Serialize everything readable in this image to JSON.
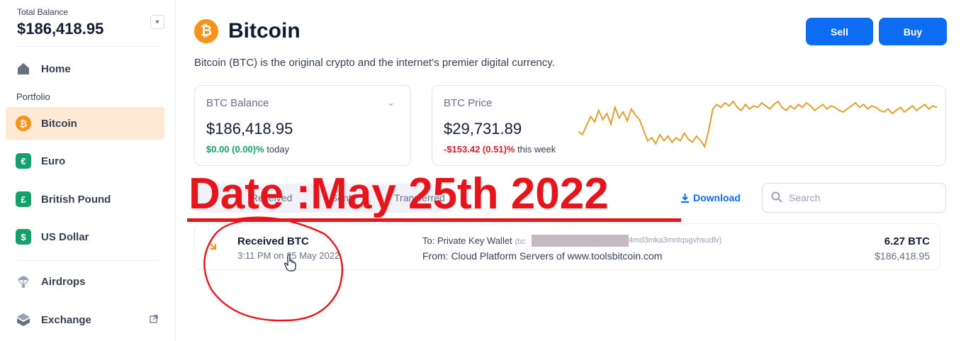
{
  "sidebar": {
    "total_balance_label": "Total Balance",
    "total_balance_value": "$186,418.95",
    "portfolio_label": "Portfolio",
    "items": [
      {
        "label": "Home",
        "icon": "home-icon"
      },
      {
        "label": "Bitcoin",
        "icon": "bitcoin-icon",
        "active": true
      },
      {
        "label": "Euro",
        "icon": "euro-icon"
      },
      {
        "label": "British Pound",
        "icon": "pound-icon"
      },
      {
        "label": "US Dollar",
        "icon": "dollar-icon"
      },
      {
        "label": "Airdrops",
        "icon": "parachute-icon"
      },
      {
        "label": "Exchange",
        "icon": "exchange-icon"
      }
    ]
  },
  "header": {
    "title": "Bitcoin",
    "description": "Bitcoin (BTC) is the original crypto and the internet’s premier digital currency.",
    "sell_label": "Sell",
    "buy_label": "Buy"
  },
  "balance_card": {
    "label": "BTC Balance",
    "value": "$186,418.95",
    "change": "$0.00 (0.00)%",
    "change_suffix": " today"
  },
  "price_card": {
    "label": "BTC Price",
    "value": "$29,731.89",
    "change": "-$153.42 (0.51)%",
    "change_suffix": " this week",
    "line_color": "#e0a030",
    "sparkline": [
      42,
      38,
      50,
      62,
      55,
      70,
      58,
      66,
      52,
      74,
      60,
      68,
      56,
      72,
      64,
      58,
      44,
      30,
      34,
      26,
      38,
      30,
      36,
      28,
      34,
      30,
      40,
      32,
      28,
      36,
      30,
      22,
      44,
      72,
      78,
      74,
      80,
      76,
      82,
      74,
      70,
      78,
      72,
      76,
      74,
      80,
      76,
      72,
      78,
      82,
      74,
      70,
      76,
      72,
      78,
      74,
      80,
      76,
      70,
      74,
      78,
      72,
      76,
      74,
      70,
      68,
      72,
      76,
      80,
      74,
      78,
      72,
      76,
      74,
      70,
      68,
      72,
      66,
      70,
      74,
      68,
      72,
      76,
      70,
      74,
      78,
      72,
      76,
      74
    ]
  },
  "tabs": [
    "Received",
    "Sent",
    "Transferred"
  ],
  "toolbar": {
    "download_label": "Download",
    "search_placeholder": "Search"
  },
  "transaction": {
    "title": "Received BTC",
    "time": "3:11 PM on 25 May 2022",
    "to_label": "To: Private Key Wallet",
    "address_start": "(bc",
    "address_end": "4md3mka3mntqsgvhsudlv)",
    "from_label": "From: Cloud Platform Servers of www.toolsbitcoin.com",
    "amount": "6.27 BTC",
    "fiat": "$186,418.95"
  },
  "overlay": {
    "date_text": "Date :May 25th 2022",
    "color": "#e8141c"
  }
}
